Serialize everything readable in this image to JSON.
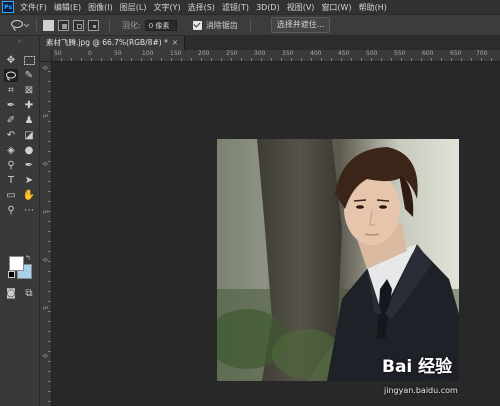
{
  "app": {
    "logo": "Ps"
  },
  "menubar": {
    "items": [
      "文件(F)",
      "编辑(E)",
      "图像(I)",
      "图层(L)",
      "文字(Y)",
      "选择(S)",
      "滤镜(T)",
      "3D(D)",
      "视图(V)",
      "窗口(W)",
      "帮助(H)"
    ]
  },
  "options": {
    "tool_icon": "lasso-icon",
    "feather_label": "羽化:",
    "feather_value": "0 像素",
    "antialias_label": "消除锯齿",
    "antialias_checked": true,
    "select_mask_label": "选择并遮住..."
  },
  "document": {
    "tab_title": "素材飞腾.jpg @ 66.7%(RGB/8#) *",
    "close_glyph": "×"
  },
  "ruler": {
    "h_labels": [
      "50",
      "0",
      "50",
      "100",
      "150",
      "200",
      "250",
      "300",
      "350",
      "400",
      "450",
      "500",
      "550",
      "600",
      "650",
      "700",
      "750"
    ],
    "v_labels": [
      "0",
      "5",
      "0",
      "5",
      "0",
      "5",
      "0"
    ]
  },
  "colors": {
    "foreground": "#ffffff",
    "background": "#a7d1ea",
    "accent": "#31a8ff"
  },
  "watermark": {
    "logo": "Bai 经验",
    "sub": "jingyan.baidu.com"
  }
}
